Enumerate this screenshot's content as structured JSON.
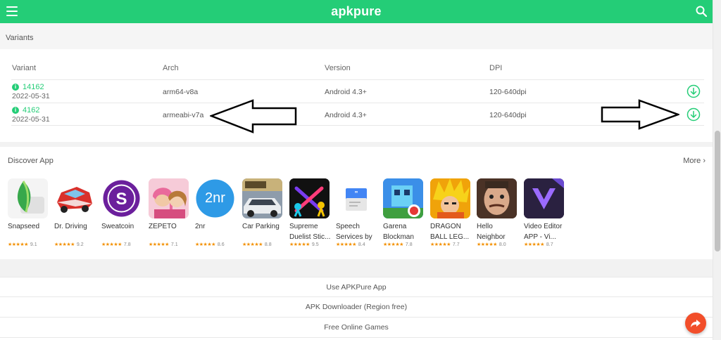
{
  "header": {
    "logo": "apkpure",
    "menu_icon": "menu-icon",
    "search_icon": "search-icon"
  },
  "variants": {
    "section_title": "Variants",
    "columns": [
      "Variant",
      "Arch",
      "Version",
      "DPI"
    ],
    "rows": [
      {
        "id": "14162",
        "date": "2022-05-31",
        "arch": "arm64-v8a",
        "version": "Android 4.3+",
        "dpi": "120-640dpi"
      },
      {
        "id": "4162",
        "date": "2022-05-31",
        "arch": "armeabi-v7a",
        "version": "Android 4.3+",
        "dpi": "120-640dpi"
      }
    ]
  },
  "discover": {
    "title": "Discover App",
    "more": "More",
    "apps": [
      {
        "name": "Snapseed",
        "rating": "9.1"
      },
      {
        "name": "Dr. Driving",
        "rating": "9.2"
      },
      {
        "name": "Sweatcoin",
        "rating": "7.8"
      },
      {
        "name": "ZEPETO",
        "rating": "7.1"
      },
      {
        "name": "2nr",
        "rating": "8.6",
        "icon_text": "2nr"
      },
      {
        "name": "Car Parking",
        "rating": "8.8"
      },
      {
        "name": "Supreme Duelist Stic...",
        "rating": "9.5"
      },
      {
        "name": "Speech Services by ...",
        "rating": "8.4"
      },
      {
        "name": "Garena Blockman GO",
        "rating": "7.8"
      },
      {
        "name": "DRAGON BALL LEG...",
        "rating": "7.7"
      },
      {
        "name": "Hello Neighbor",
        "rating": "8.0"
      },
      {
        "name": "Video Editor APP - Vi...",
        "rating": "8.7"
      }
    ]
  },
  "footer_links": [
    "Use APKPure App",
    "APK Downloader (Region free)",
    "Free Online Games"
  ],
  "colors": {
    "brand": "#24cd77",
    "fab": "#f24e2a",
    "rating": "#f39000"
  }
}
